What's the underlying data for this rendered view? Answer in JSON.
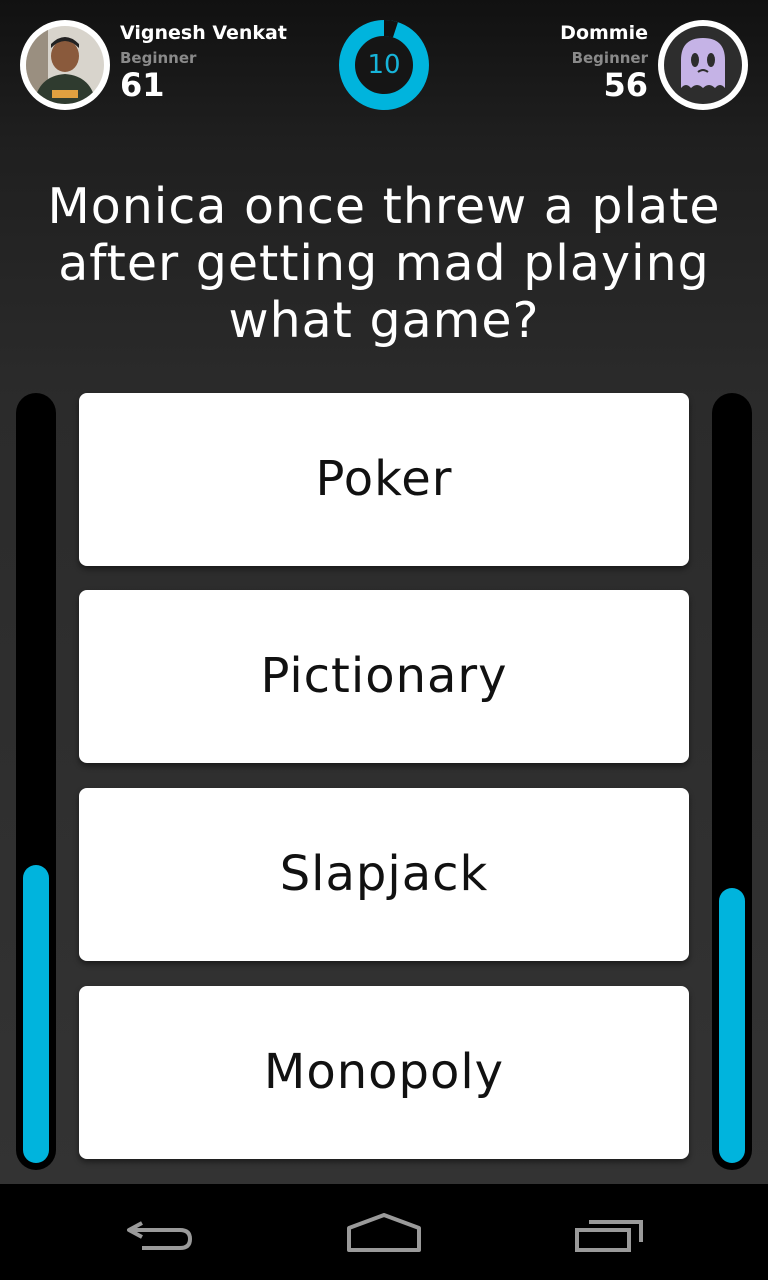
{
  "player_left": {
    "name": "Vignesh Venkat",
    "level": "Beginner",
    "score": "61",
    "progress": 0.39
  },
  "player_right": {
    "name": "Dommie",
    "level": "Beginner",
    "score": "56",
    "progress": 0.36
  },
  "timer": {
    "value": "10",
    "fraction": 0.05
  },
  "question": "Monica once threw a plate after getting mad playing what game?",
  "answers": [
    "Poker",
    "Pictionary",
    "Slapjack",
    "Monopoly"
  ],
  "colors": {
    "accent": "#00b4dd",
    "ghost": "#c5b3e6",
    "background": "#2b2b2b"
  },
  "nav": {
    "back_icon": "back-icon",
    "home_icon": "home-icon",
    "recents_icon": "recents-icon"
  }
}
